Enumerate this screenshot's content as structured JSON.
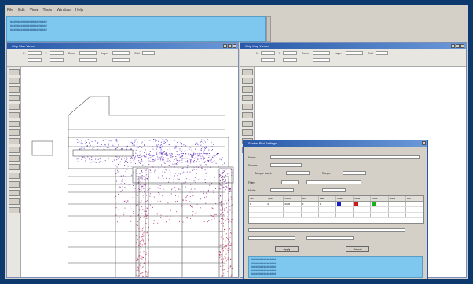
{
  "menubar": {
    "items": [
      "File",
      "Edit",
      "View",
      "Tools",
      "Window",
      "Help"
    ]
  },
  "status_panel": {
    "lines": [
      "#####################",
      "#####################",
      "#####################"
    ]
  },
  "left_window": {
    "title": "Chip Map Viewer",
    "toolbar_labels": [
      "X:",
      "Y:",
      "Zoom",
      "Layer",
      "Grid"
    ]
  },
  "right_window": {
    "title": "Chip Map Viewer",
    "toolbar_labels": [
      "X:",
      "Y:",
      "Zoom",
      "Layer",
      "Grid"
    ]
  },
  "dialog": {
    "title": "Scatter Plot Settings",
    "field_labels": [
      "Name:",
      "Source:",
      "Sample count:",
      "Range:",
      "Filter:",
      "Mode:"
    ],
    "table_header": [
      "Set",
      "Type",
      "Count",
      "Min",
      "Max",
      "Color",
      "Color",
      "Color",
      "Show",
      "Opt"
    ],
    "table_rows": [
      [
        "1",
        "A",
        "2048",
        "0",
        "1",
        "blue",
        "red",
        "green",
        "",
        ""
      ]
    ],
    "swatch_colors": [
      "#1a1ad0",
      "#d01a1a",
      "#1ab01a"
    ],
    "buttons": [
      "Apply",
      "Cancel"
    ],
    "log_lines": [
      "################",
      "################",
      "################",
      "################",
      "################"
    ]
  },
  "colors": {
    "desktop": "#0d3a6e",
    "scatter_top": "#3a1acc",
    "scatter_bottom": "#c01a4a",
    "accent_title": "#2858a8"
  }
}
